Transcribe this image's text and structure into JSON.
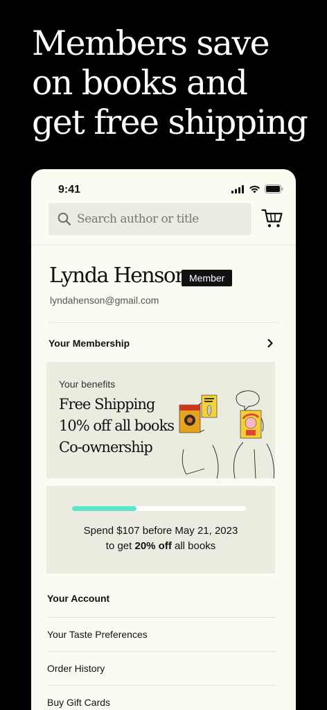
{
  "headline": {
    "line1": "Members save",
    "line2": "on books and",
    "line3": "get free shipping"
  },
  "status_bar": {
    "time": "9:41",
    "icons": [
      "signal-icon",
      "wifi-icon",
      "battery-icon"
    ]
  },
  "search": {
    "placeholder": "Search author or title",
    "icon": "search-icon"
  },
  "cart": {
    "icon": "cart-icon"
  },
  "profile": {
    "name": "Lynda Henson",
    "badge": "Member",
    "email": "lyndahenson@gmail.com"
  },
  "membership": {
    "label": "Your Membership",
    "icon": "chevron-right-icon"
  },
  "benefits": {
    "caption": "Your benefits",
    "items": [
      "Free Shipping",
      "10% off all books",
      "Co-ownership"
    ]
  },
  "progress": {
    "fraction": 0.37,
    "line1": "Spend $107 before May 21, 2023",
    "line2_prefix": "to get",
    "line2_bold": "20% off",
    "line2_suffix": "all books"
  },
  "account": {
    "heading": "Your Account",
    "items": [
      "Your Taste Preferences",
      "Order History",
      "Buy Gift Cards"
    ]
  },
  "colors": {
    "background": "#000000",
    "phone_bg": "#fbfbf2",
    "card_bg": "#ebebe0",
    "accent": "#5be5cf",
    "badge_bg": "#111111"
  }
}
